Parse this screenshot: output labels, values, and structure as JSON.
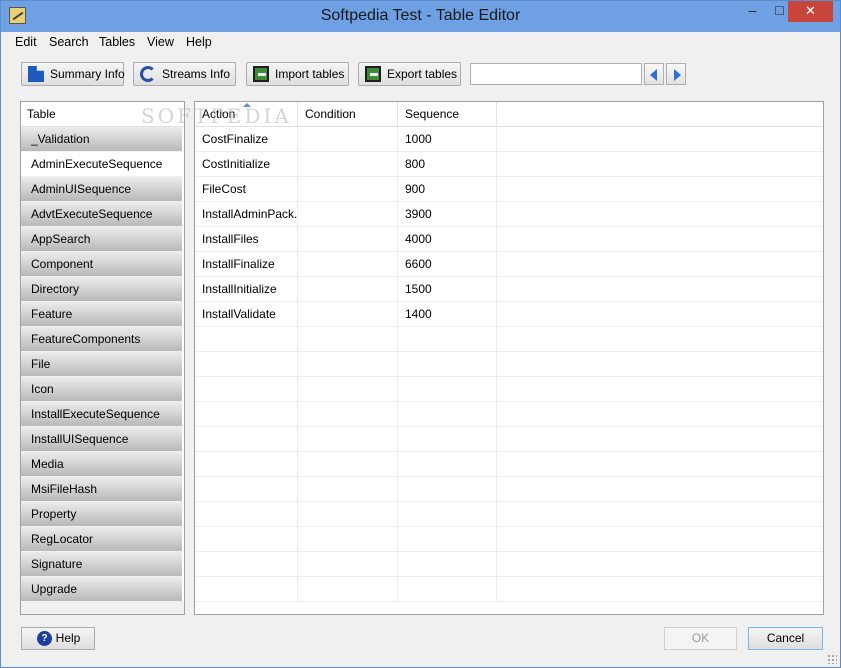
{
  "window": {
    "title": "Softpedia Test - Table Editor",
    "minimize_glyph": "‒",
    "maximize_glyph": "□",
    "close_glyph": "✕"
  },
  "menu": [
    "Edit",
    "Search",
    "Tables",
    "View",
    "Help"
  ],
  "toolbar": {
    "summary_info": "Summary Info",
    "streams_info": "Streams Info",
    "import_tables": "Import tables",
    "export_tables": "Export tables",
    "search_value": "",
    "icons": [
      "summary-icon",
      "streams-icon",
      "import-icon",
      "export-icon",
      "previous-arrow-icon",
      "next-arrow-icon"
    ]
  },
  "tables_panel": {
    "header": "Table",
    "selected_index": 1,
    "items": [
      "_Validation",
      "AdminExecuteSequence",
      "AdminUISequence",
      "AdvtExecuteSequence",
      "AppSearch",
      "Component",
      "Directory",
      "Feature",
      "FeatureComponents",
      "File",
      "Icon",
      "InstallExecuteSequence",
      "InstallUISequence",
      "Media",
      "MsiFileHash",
      "Property",
      "RegLocator",
      "Signature",
      "Upgrade"
    ]
  },
  "grid": {
    "columns": [
      "Action",
      "Condition",
      "Sequence"
    ],
    "rows": [
      {
        "action": "CostFinalize",
        "condition": "",
        "sequence": "1000"
      },
      {
        "action": "CostInitialize",
        "condition": "",
        "sequence": "800"
      },
      {
        "action": "FileCost",
        "condition": "",
        "sequence": "900"
      },
      {
        "action": "InstallAdminPack...",
        "condition": "",
        "sequence": "3900"
      },
      {
        "action": "InstallFiles",
        "condition": "",
        "sequence": "4000"
      },
      {
        "action": "InstallFinalize",
        "condition": "",
        "sequence": "6600"
      },
      {
        "action": "InstallInitialize",
        "condition": "",
        "sequence": "1500"
      },
      {
        "action": "InstallValidate",
        "condition": "",
        "sequence": "1400"
      }
    ],
    "empty_row_count": 11
  },
  "watermark": "SOFTPEDIA",
  "footer": {
    "help": "Help",
    "ok": "OK",
    "cancel": "Cancel"
  },
  "colors": {
    "titlebar": "#6ea0e3",
    "close": "#c7453a",
    "selection": "#ffffff"
  }
}
